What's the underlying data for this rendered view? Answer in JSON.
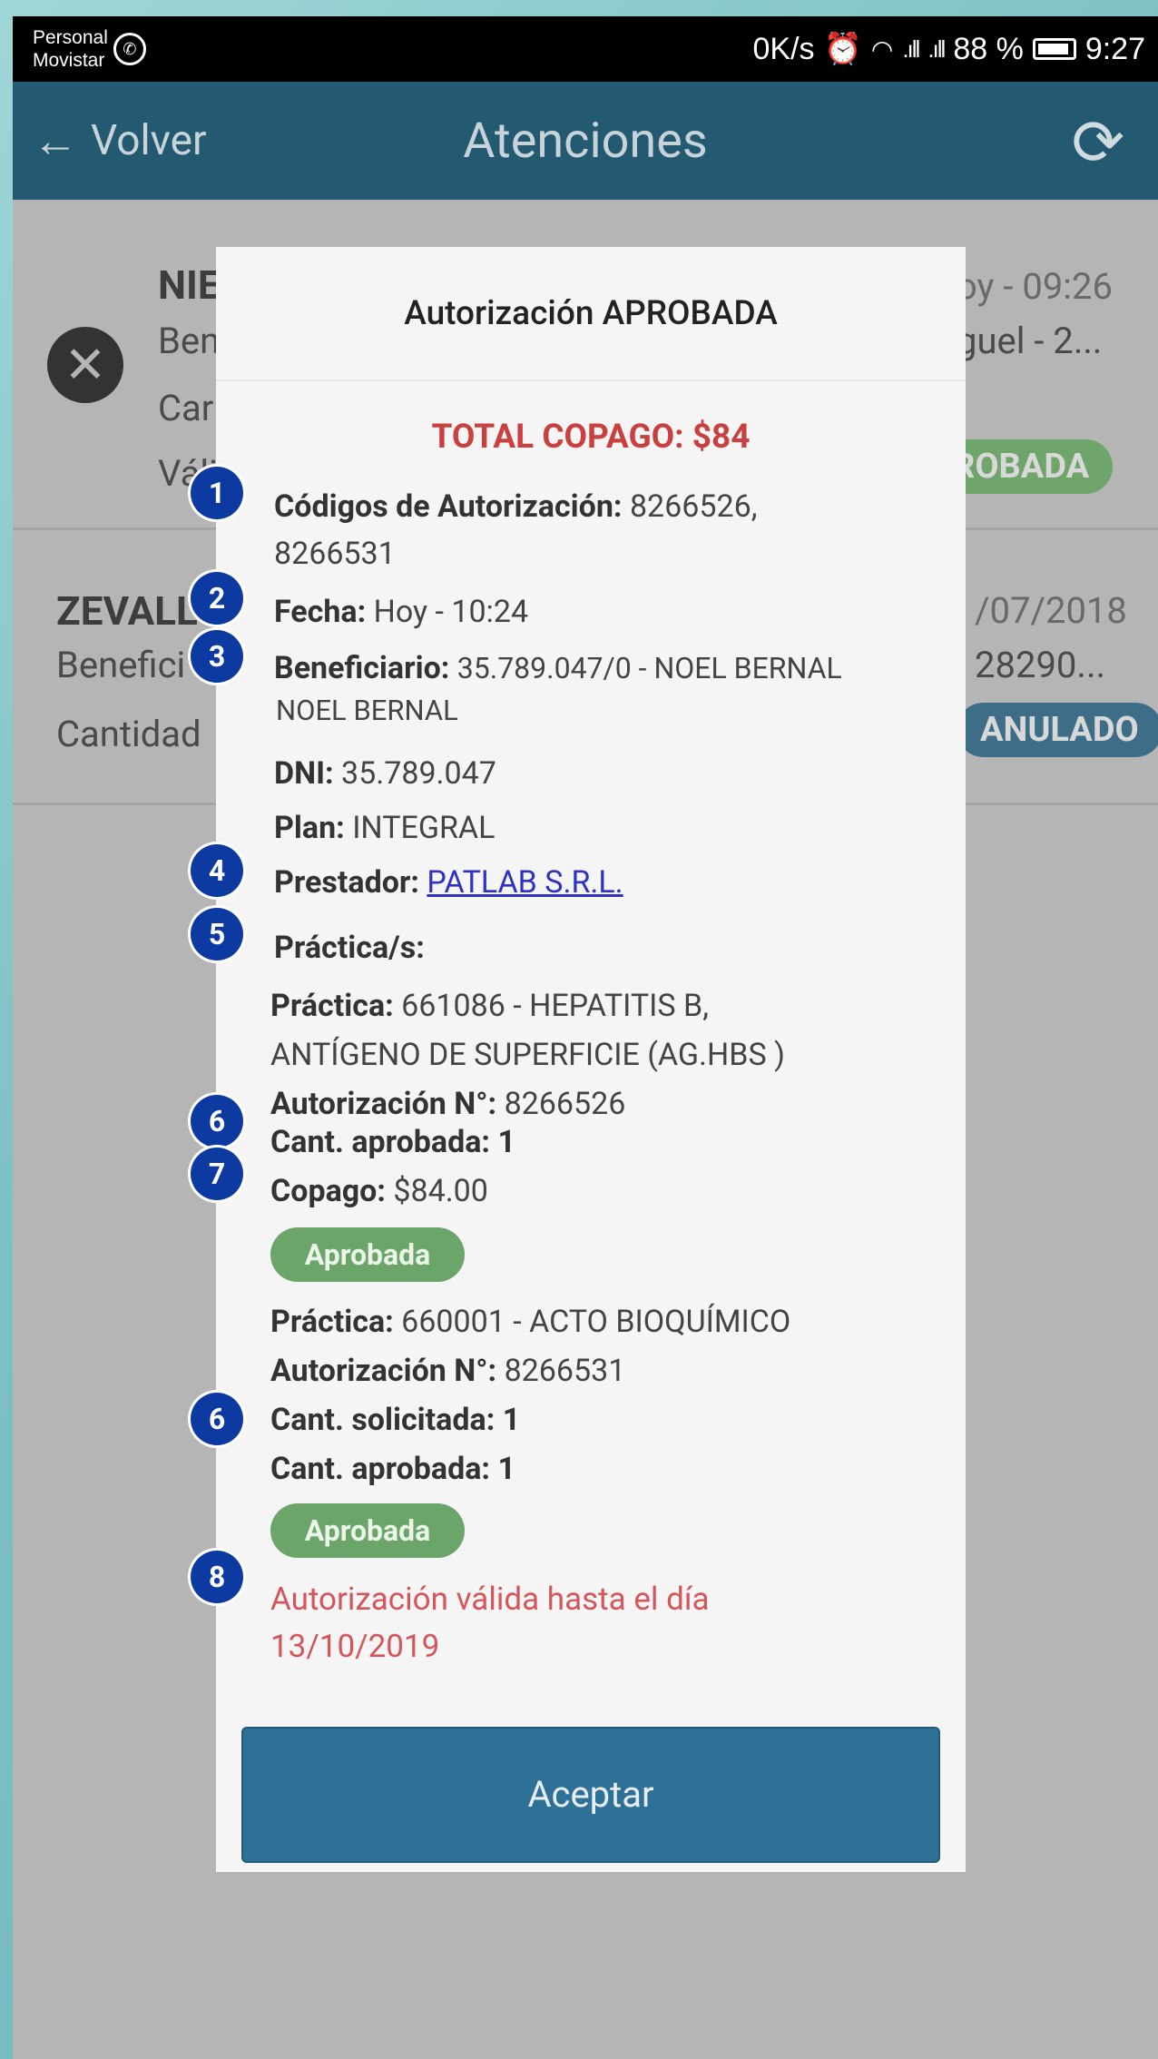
{
  "status_bar": {
    "carrier_line1": "Personal",
    "carrier_line2": "Movistar",
    "speed": "0K/s",
    "battery": "88 %",
    "time": "9:27"
  },
  "app_bar": {
    "back_label": "Volver",
    "title": "Atenciones"
  },
  "background_list": {
    "row1": {
      "name_fragment": "NIE",
      "line2_fragment": "Ben",
      "line3_fragment": "Car",
      "line4_fragment": "Váli",
      "date_fragment": "oy - 09:26",
      "right_fragment": "guel - 2...",
      "badge_fragment": "ROBADA"
    },
    "row2": {
      "name_fragment": "ZEVALL",
      "line2_fragment": "Benefici",
      "line3_fragment": "Cantidad",
      "date_fragment": "/07/2018",
      "right_fragment": "28290...",
      "badge_fragment": "ANULADO"
    }
  },
  "modal": {
    "title": "Autorización APROBADA",
    "total_copago": "TOTAL COPAGO: $84",
    "codigos_label": "Códigos de Autorización:",
    "codigos_value_1": "8266526,",
    "codigos_value_2": "8266531",
    "fecha_label": "Fecha:",
    "fecha_value": "Hoy - 10:24",
    "beneficiario_label": "Beneficiario:",
    "beneficiario_value_1": "35.789.047/0 - NOEL BERNAL",
    "beneficiario_value_2": "NOEL BERNAL",
    "dni_label": "DNI:",
    "dni_value": "35.789.047",
    "plan_label": "Plan:",
    "plan_value": "INTEGRAL",
    "prestador_label": "Prestador:",
    "prestador_value": "PATLAB S.R.L.",
    "practicas_label": "Práctica/s:",
    "practicas": [
      {
        "practica_label": "Práctica:",
        "practica_value_1": "661086 - HEPATITIS B,",
        "practica_value_2": "ANTÍGENO DE SUPERFICIE (AG.HBS )",
        "autorizacion_label": "Autorización N°:",
        "autorizacion_value": "8266526",
        "cant_aprobada": "Cant. aprobada: 1",
        "copago_label": "Copago:",
        "copago_value": "$84.00",
        "status": "Aprobada"
      },
      {
        "practica_label": "Práctica:",
        "practica_value_1": "660001 - ACTO BIOQUÍMICO",
        "autorizacion_label": "Autorización N°:",
        "autorizacion_value": "8266531",
        "cant_solicitada": "Cant. solicitada: 1",
        "cant_aprobada": "Cant. aprobada: 1",
        "status": "Aprobada"
      }
    ],
    "validity_line1": "Autorización válida hasta el día",
    "validity_line2": "13/10/2019",
    "accept_label": "Aceptar"
  },
  "markers": [
    "1",
    "2",
    "3",
    "4",
    "5",
    "6",
    "7",
    "6",
    "8"
  ],
  "colors": {
    "app_bar": "#235a72",
    "total": "#c9403f",
    "approved_chip": "#6ba56a",
    "accept_button": "#2f7196",
    "marker": "#0c3aa0"
  }
}
